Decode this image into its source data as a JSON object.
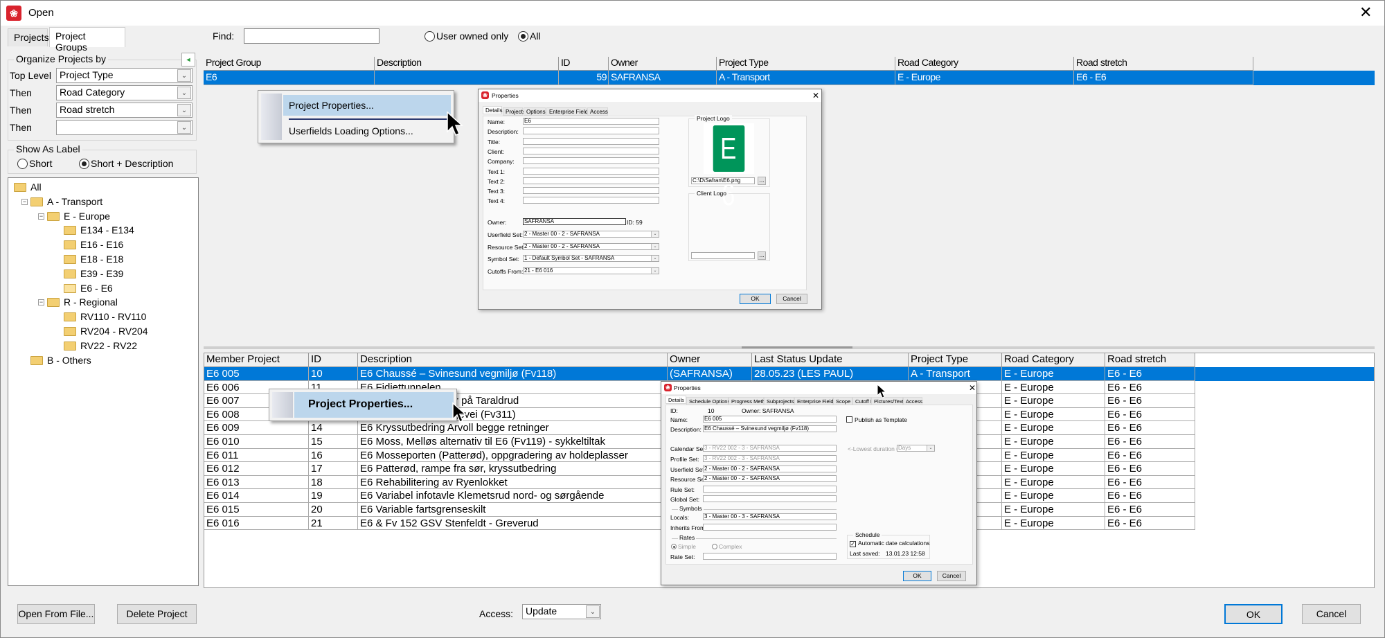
{
  "window": {
    "title": "Open",
    "close_icon": "close-icon"
  },
  "tabs": [
    {
      "label": "Projects"
    },
    {
      "label": "Project Groups",
      "active": true
    }
  ],
  "find": {
    "label": "Find:",
    "value": ""
  },
  "filter": {
    "user_owned_only": "User owned only",
    "all": "All",
    "selected": "All"
  },
  "organize": {
    "title": "Organize Projects by",
    "rows": [
      {
        "label": "Top Level",
        "value": "Project Type"
      },
      {
        "label": "Then",
        "value": "Road Category"
      },
      {
        "label": "Then",
        "value": "Road stretch"
      },
      {
        "label": "Then",
        "value": ""
      }
    ]
  },
  "show_as_label": {
    "title": "Show As Label",
    "short": "Short",
    "short_desc": "Short + Description",
    "selected": "Short + Description"
  },
  "tree": [
    {
      "label": "All",
      "level": 0,
      "toggle": ""
    },
    {
      "label": "A - Transport",
      "level": 1,
      "toggle": "-"
    },
    {
      "label": "E - Europe",
      "level": 2,
      "toggle": "-"
    },
    {
      "label": "E134 - E134",
      "level": 3,
      "toggle": ""
    },
    {
      "label": "E16 - E16",
      "level": 3,
      "toggle": ""
    },
    {
      "label": "E18 - E18",
      "level": 3,
      "toggle": ""
    },
    {
      "label": "E39 - E39",
      "level": 3,
      "toggle": ""
    },
    {
      "label": "E6 - E6",
      "level": 3,
      "toggle": "",
      "open": true
    },
    {
      "label": "R - Regional",
      "level": 2,
      "toggle": "-"
    },
    {
      "label": "RV110 - RV110",
      "level": 3,
      "toggle": ""
    },
    {
      "label": "RV204 - RV204",
      "level": 3,
      "toggle": ""
    },
    {
      "label": "RV22 - RV22",
      "level": 3,
      "toggle": ""
    },
    {
      "label": "B - Others",
      "level": 1,
      "toggle": ""
    }
  ],
  "group_grid": {
    "columns": [
      "Project Group",
      "Description",
      "ID",
      "Owner",
      "Project Type",
      "Road Category",
      "Road stretch"
    ],
    "rows": [
      [
        "E6",
        "",
        "59",
        "SAFRANSA",
        "A - Transport",
        "E - Europe",
        "E6 - E6"
      ]
    ]
  },
  "member_grid": {
    "columns": [
      "Member Project",
      "ID",
      "Description",
      "Owner",
      "Last Status Update",
      "Project Type",
      "Road Category",
      "Road stretch"
    ],
    "rows": [
      [
        "E6 005",
        "10",
        "E6 Chaussé – Svinesund vegmiljø (Fv118)",
        "(SAFRANSA)",
        "28.05.23 (LES PAUL)",
        "A - Transport",
        "E - Europe",
        "E6 - E6"
      ],
      [
        "E6 006",
        "11",
        "E6 Fidjettunnelen",
        "",
        "",
        "",
        "E - Europe",
        "E6 - E6"
      ],
      [
        "E6 007",
        "",
        "r på Taraldrud",
        "",
        "",
        "",
        "E - Europe",
        "E6 - E6"
      ],
      [
        "E6 008",
        "",
        "gevei (Fv311)",
        "",
        "",
        "",
        "E - Europe",
        "E6 - E6"
      ],
      [
        "E6 009",
        "14",
        "E6 Kryssutbedring Arvoll begge retninger",
        "",
        "",
        "",
        "E - Europe",
        "E6 - E6"
      ],
      [
        "E6 010",
        "15",
        "E6 Moss, Melløs alternativ til E6 (Fv119) - sykkeltiltak",
        "",
        "",
        "",
        "E - Europe",
        "E6 - E6"
      ],
      [
        "E6 011",
        "16",
        "E6 Mosseporten (Patterød), oppgradering av holdeplasser",
        "",
        "",
        "",
        "E - Europe",
        "E6 - E6"
      ],
      [
        "E6 012",
        "17",
        "E6 Patterød, rampe fra sør, kryssutbedring",
        "",
        "",
        "",
        "E - Europe",
        "E6 - E6"
      ],
      [
        "E6 013",
        "18",
        "E6 Rehabilitering av Ryenlokket",
        "",
        "",
        "",
        "E - Europe",
        "E6 - E6"
      ],
      [
        "E6 014",
        "19",
        "E6 Variabel infotavle Klemetsrud nord- og sørgående",
        "",
        "",
        "",
        "E - Europe",
        "E6 - E6"
      ],
      [
        "E6 015",
        "20",
        "E6 Variable fartsgrenseskilt",
        "",
        "",
        "",
        "E - Europe",
        "E6 - E6"
      ],
      [
        "E6 016",
        "21",
        "E6 & Fv 152 GSV Stenfeldt - Greverud",
        "",
        "",
        "",
        "E - Europe",
        "E6 - E6"
      ]
    ]
  },
  "context_menu_top": {
    "items": [
      "Project Properties...",
      "Userfields Loading Options..."
    ]
  },
  "context_menu_bottom": {
    "items": [
      "Project Properties..."
    ]
  },
  "group_properties": {
    "title": "Properties",
    "tabs": [
      "Details",
      "Projects",
      "Options",
      "Enterprise Fields",
      "Access"
    ],
    "fields": [
      {
        "label": "Name:",
        "value": "E6"
      },
      {
        "label": "Description:",
        "value": ""
      },
      {
        "label": "Title:",
        "value": ""
      },
      {
        "label": "Client:",
        "value": ""
      },
      {
        "label": "Company:",
        "value": ""
      },
      {
        "label": "Text 1:",
        "value": ""
      },
      {
        "label": "Text 2:",
        "value": ""
      },
      {
        "label": "Text 3:",
        "value": ""
      },
      {
        "label": "Text 4:",
        "value": ""
      }
    ],
    "owner": {
      "label": "Owner:",
      "value": "SAFRANSA",
      "id_text": "ID: 59"
    },
    "sets": [
      {
        "label": "Userfield Set:",
        "value": "2 - Master 00 - 2 - SAFRANSA"
      },
      {
        "label": "Resource Set:",
        "value": "2 - Master 00 - 2 - SAFRANSA"
      },
      {
        "label": "Symbol Set:",
        "value": "1 - Default Symbol Set - SAFRANSA"
      },
      {
        "label": "Cutoffs From:",
        "value": "21 - E6 016"
      }
    ],
    "project_logo": {
      "title": "Project Logo",
      "logo_text": "E 6",
      "logo_color": "#00955a",
      "path": "C:\\D\\Safran\\E6.png",
      "browse": "..."
    },
    "client_logo": {
      "title": "Client Logo",
      "path": "",
      "browse": "..."
    },
    "ok": "OK",
    "cancel": "Cancel"
  },
  "project_properties": {
    "title": "Properties",
    "tabs": [
      "Details",
      "Schedule Options",
      "Progress Method",
      "Subprojects",
      "Enterprise Fields",
      "Scope",
      "Cutoff Dates",
      "Pictures/Texts",
      "Access"
    ],
    "id_label": "ID:",
    "id": "10",
    "owner": "Owner: SAFRANSA",
    "name_label": "Name:",
    "name": "E6 005",
    "desc_label": "Description:",
    "desc": "E6 Chaussé – Svinesund vegmiljø (Fv118)",
    "publish": "Publish as Template",
    "sets": [
      {
        "label": "Calendar Set:",
        "value": "3 - RV22 002 - 3 - SAFRANSA",
        "disabled": true
      },
      {
        "label": "Profile Set:",
        "value": "3 - RV22 002 - 3 - SAFRANSA",
        "disabled": true
      },
      {
        "label": "Userfield Set:",
        "value": "2 - Master 00 - 2 - SAFRANSA"
      },
      {
        "label": "Resource Set:",
        "value": "2 - Master 00 - 2 - SAFRANSA"
      },
      {
        "label": "Rule Set:",
        "value": ""
      },
      {
        "label": "Global Set:",
        "value": ""
      }
    ],
    "lowest_duration": "<-Lowest duration units",
    "duration_unit": "Days",
    "symbols": "Symbols",
    "locals_label": "Locals:",
    "locals": "3 - Master 00 - 3 - SAFRANSA",
    "inherits_label": "Inherits From:",
    "inherits": "",
    "rates": "Rates",
    "simple": "Simple",
    "complex": "Complex",
    "rate_set_label": "Rate Set:",
    "rate_set": "",
    "schedule": "Schedule",
    "auto_calc": "Automatic date calculations",
    "auto_calc_checked": true,
    "last_saved_label": "Last saved:",
    "last_saved": "13.01.23 12:58",
    "ok": "OK",
    "cancel": "Cancel"
  },
  "footer": {
    "open_from_file": "Open From File...",
    "delete_project": "Delete Project",
    "access_label": "Access:",
    "access_value": "Update",
    "ok": "OK",
    "cancel": "Cancel"
  },
  "colors": {
    "selection": "#0078d7",
    "app_red": "#d9232d"
  }
}
